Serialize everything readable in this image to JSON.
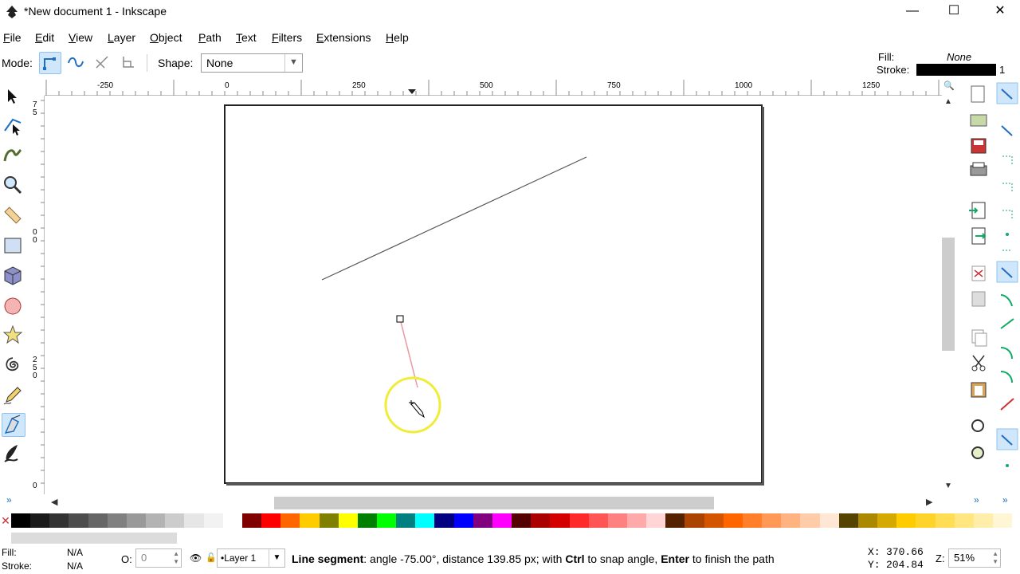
{
  "window": {
    "title": "*New document 1 - Inkscape",
    "minimize": "—",
    "maximize": "☐",
    "close": "✕"
  },
  "menu": [
    "File",
    "Edit",
    "View",
    "Layer",
    "Object",
    "Path",
    "Text",
    "Filters",
    "Extensions",
    "Help"
  ],
  "toolbar": {
    "mode_label": "Mode:",
    "shape_label": "Shape:",
    "shape_value": "None"
  },
  "style_indicator": {
    "fill_label": "Fill:",
    "fill_value": "None",
    "stroke_label": "Stroke:",
    "stroke_width": "1",
    "stroke_color": "#000000"
  },
  "ruler_top_labels": [
    "-250",
    "0",
    "250",
    "500",
    "750",
    "1000",
    "1250"
  ],
  "ruler_left_labels": [
    "7",
    "5",
    "0",
    "0",
    "2",
    "5",
    "0",
    "0"
  ],
  "status": {
    "fill_label": "Fill:",
    "fill_value": "N/A",
    "stroke_label": "Stroke:",
    "stroke_value": "N/A",
    "opacity_label": "O:",
    "opacity_value": "0",
    "layer": "•Layer 1",
    "message_bold1": "Line segment",
    "message_part1": ": angle -75.00°, distance 139.85 px; with ",
    "message_bold2": "Ctrl",
    "message_part2": " to snap angle, ",
    "message_bold3": "Enter",
    "message_part3": " to finish the path",
    "x_label": "X:",
    "x_value": "370.66",
    "y_label": "Y:",
    "y_value": "204.84",
    "zoom_label": "Z:",
    "zoom_value": "51%"
  },
  "palette": [
    "#000000",
    "#1a1a1a",
    "#333333",
    "#4d4d4d",
    "#666666",
    "#808080",
    "#999999",
    "#b3b3b3",
    "#cccccc",
    "#e6e6e6",
    "#f2f2f2",
    "#ffffff",
    "#800000",
    "#ff0000",
    "#ff6600",
    "#ffcc00",
    "#808000",
    "#ffff00",
    "#008000",
    "#00ff00",
    "#008080",
    "#00ffff",
    "#000080",
    "#0000ff",
    "#800080",
    "#ff00ff",
    "#550000",
    "#aa0000",
    "#d40000",
    "#ff2a2a",
    "#ff5555",
    "#ff8080",
    "#ffaaaa",
    "#ffd5d5",
    "#552200",
    "#aa4400",
    "#d45500",
    "#ff6600",
    "#ff7f2a",
    "#ff9955",
    "#ffb380",
    "#ffccaa",
    "#ffe6d5",
    "#554400",
    "#aa8800",
    "#d4aa00",
    "#ffcc00",
    "#ffd42a",
    "#ffdd55",
    "#ffe680",
    "#ffeeaa",
    "#fff6d5"
  ],
  "colors": {
    "accent": "#8fc3f0",
    "cursor_ring": "#f0ec3a",
    "preview_line": "#e89aa0"
  }
}
